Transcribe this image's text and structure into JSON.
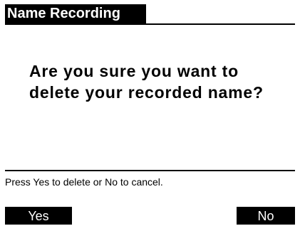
{
  "header": {
    "title": "Name Recording"
  },
  "dialog": {
    "line1": "Are you sure you want to",
    "line2": "delete your recorded name?"
  },
  "hint": {
    "text": "Press Yes to delete or No to cancel."
  },
  "softkeys": {
    "left_label": "Yes",
    "right_label": "No"
  },
  "colors": {
    "background": "#ffffff",
    "foreground": "#000000",
    "inverse_text": "#ffffff"
  }
}
